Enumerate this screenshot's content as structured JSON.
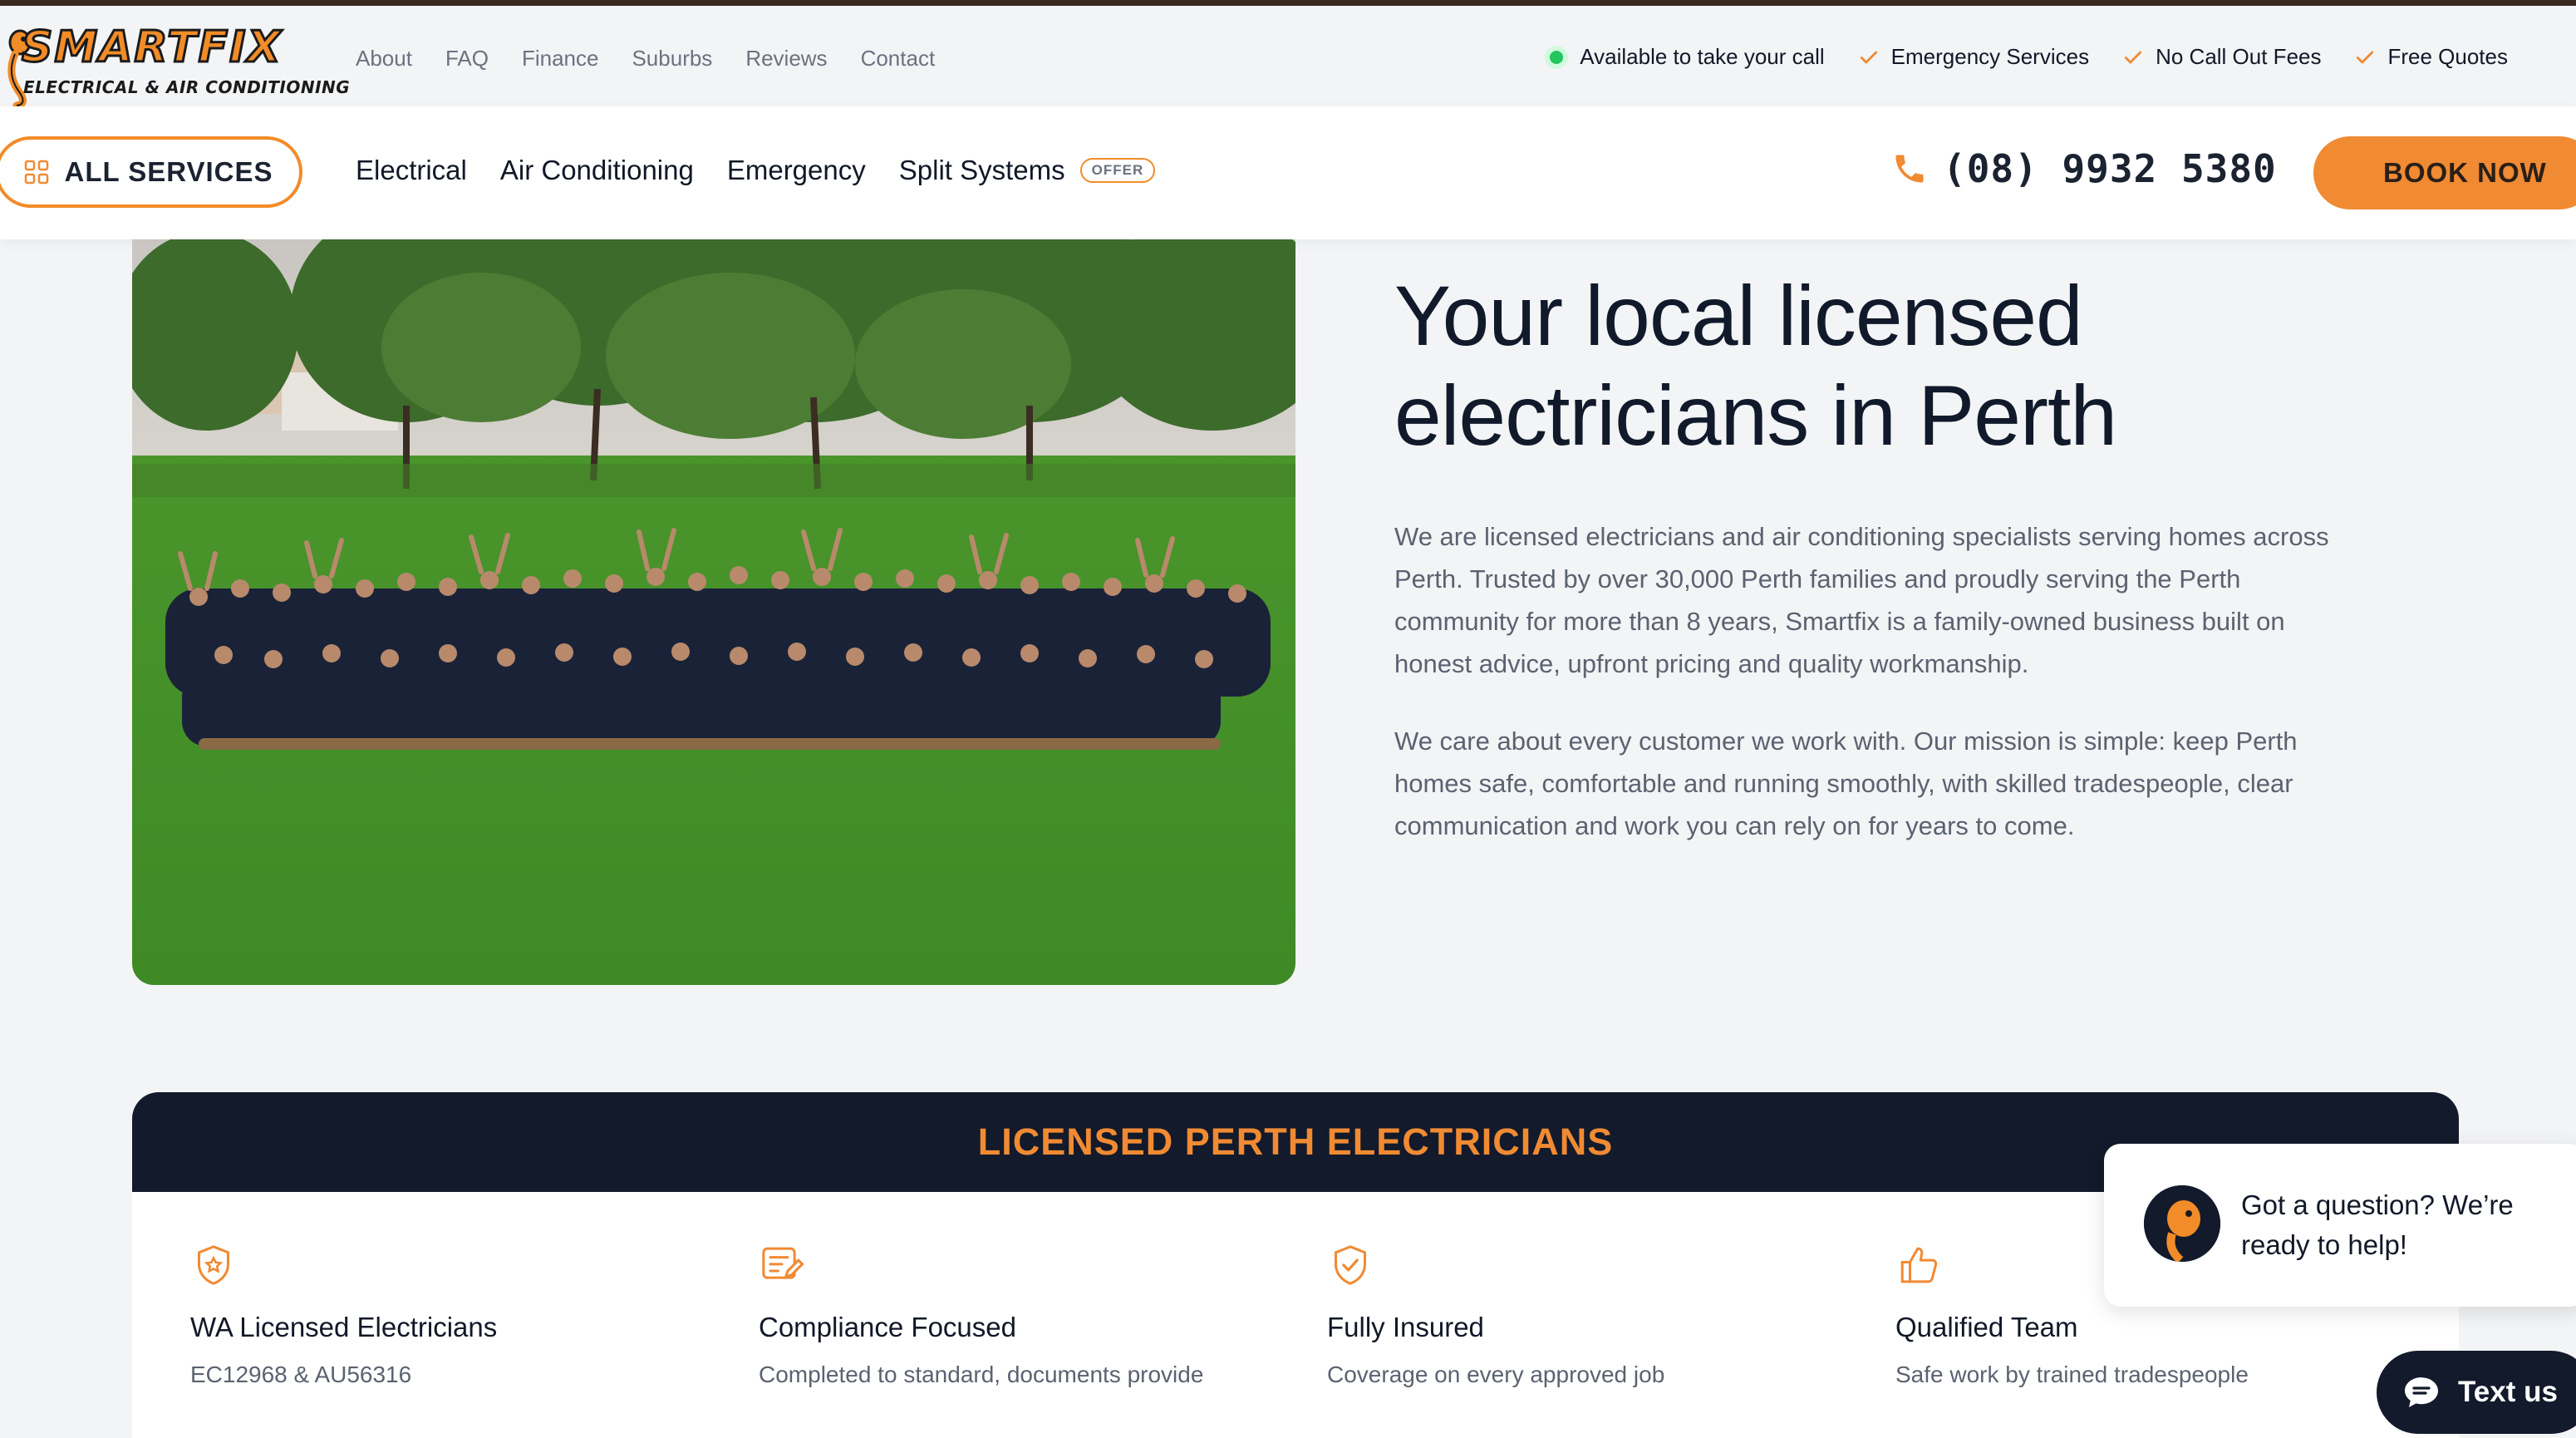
{
  "brand": {
    "name": "SMARTFIX",
    "tagline": "ELECTRICAL & AIR CONDITIONING",
    "accent_color": "#f08a33",
    "dark_color": "#121a2b"
  },
  "top_nav": {
    "links": [
      "About",
      "FAQ",
      "Finance",
      "Suburbs",
      "Reviews",
      "Contact"
    ]
  },
  "badges": {
    "availability": "Available to take your call",
    "items": [
      "Emergency Services",
      "No Call Out Fees",
      "Free Quotes"
    ]
  },
  "main_nav": {
    "all_services_label": "ALL SERVICES",
    "links": [
      "Electrical",
      "Air Conditioning",
      "Emergency",
      "Split Systems"
    ],
    "offer_badge": "OFFER",
    "phone": "(08) 9932 5380",
    "book_now_label": "BOOK NOW"
  },
  "hero": {
    "title_line1": "Your local licensed",
    "title_line2": "electricians in Perth",
    "paragraph1": "We are licensed electricians and air conditioning specialists serving homes across Perth. Trusted by over 30,000 Perth families and proudly serving the Perth community for more than 8 years, Smartfix is a family-owned business built on honest advice, upfront pricing and quality workmanship.",
    "paragraph2": "We care about every customer we work with. Our mission is simple: keep Perth homes safe, comfortable and running smoothly, with skilled tradespeople, clear communication and work you can rely on for years to come."
  },
  "licensed_section": {
    "heading": "LICENSED PERTH ELECTRICIANS",
    "features": [
      {
        "icon": "shield-star-icon",
        "title": "WA Licensed Electricians",
        "desc": "EC12968 & AU56316"
      },
      {
        "icon": "document-edit-icon",
        "title": "Compliance Focused",
        "desc": "Completed to standard, documents provide"
      },
      {
        "icon": "shield-check-icon",
        "title": "Fully Insured",
        "desc": "Coverage on every approved job"
      },
      {
        "icon": "thumbs-up-icon",
        "title": "Qualified Team",
        "desc": "Safe work by trained tradespeople"
      }
    ]
  },
  "chat": {
    "message_line1": "Got a question? We’re",
    "message_line2": "ready to help!",
    "text_us_label": "Text us"
  }
}
